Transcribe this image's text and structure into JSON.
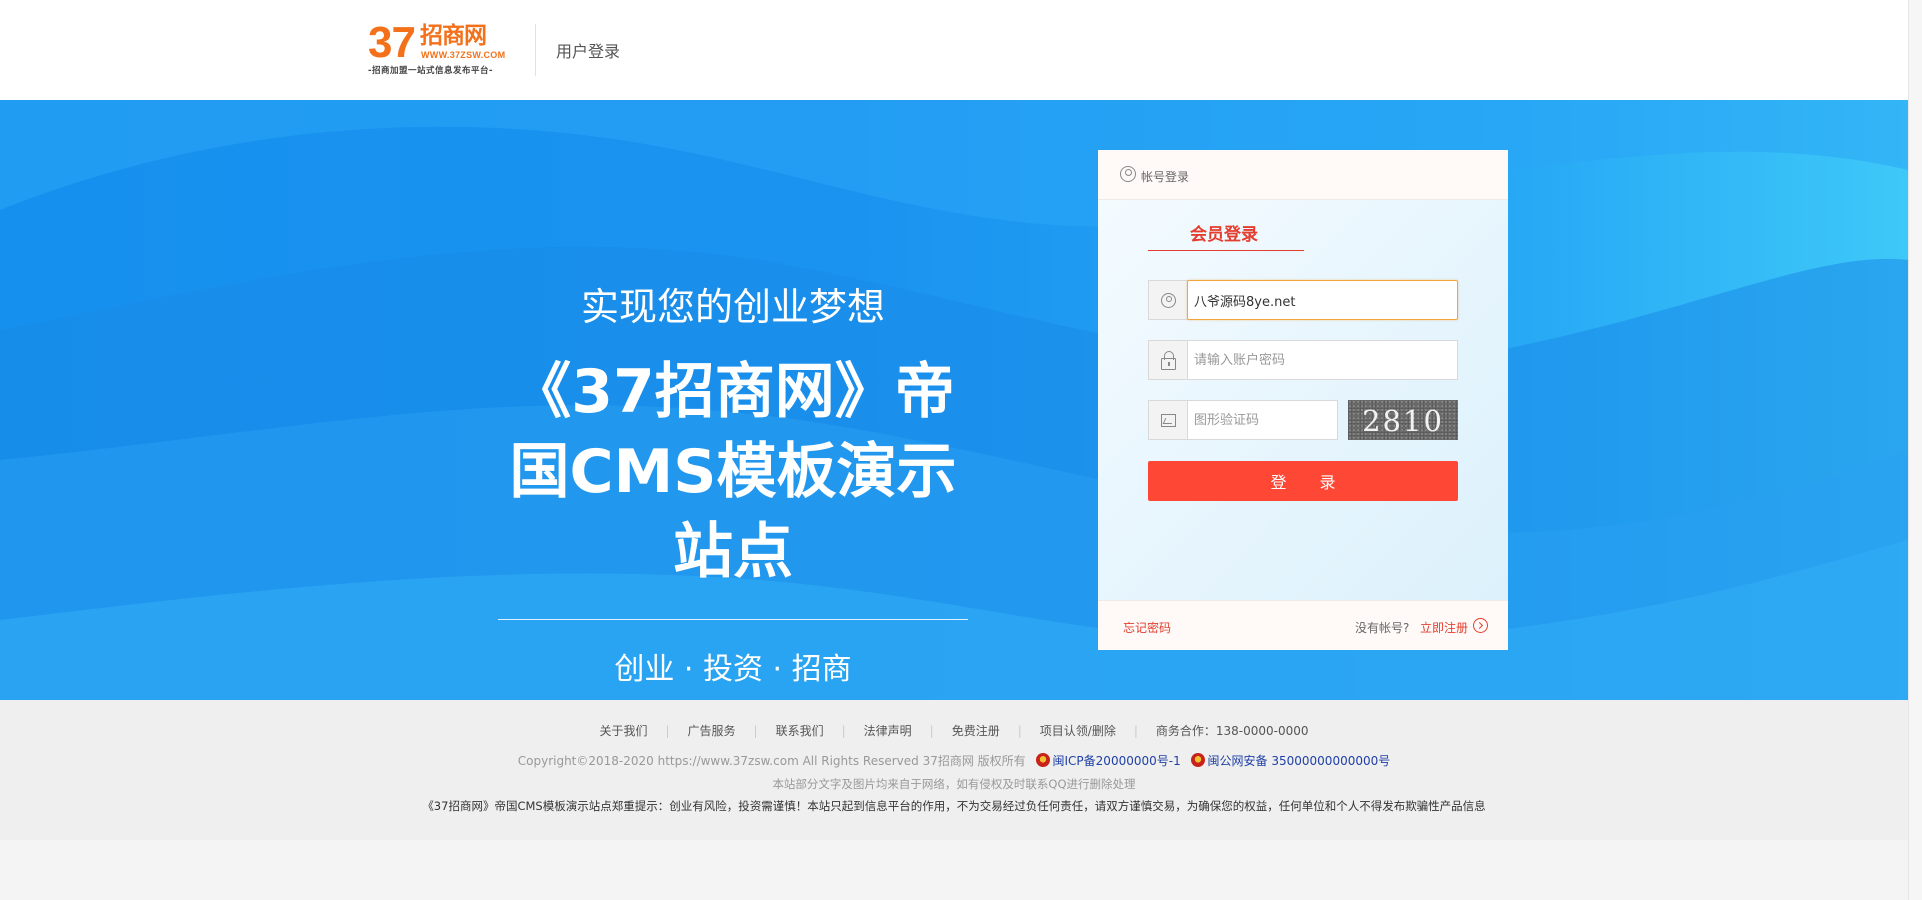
{
  "header": {
    "logo": {
      "number": "37",
      "name": "招商网",
      "url": "WWW.37ZSW.COM",
      "slogan": "-招商加盟一站式信息发布平台-"
    },
    "title": "用户登录"
  },
  "banner": {
    "slogan_top": "实现您的创业梦想",
    "headline": "《37招商网》帝国CMS模板演示站点",
    "slogan_bottom": "创业 · 投资 · 招商"
  },
  "login": {
    "tab_label": "帐号登录",
    "member_title": "会员登录",
    "username_value": "八爷源码8ye.net",
    "password_placeholder": "请输入账户密码",
    "captcha_placeholder": "图形验证码",
    "captcha_code": "2810",
    "submit_label": "登 录",
    "forgot_label": "忘记密码",
    "no_account_label": "没有帐号?",
    "register_label": "立即注册"
  },
  "footer": {
    "links": [
      "关于我们",
      "广告服务",
      "联系我们",
      "法律声明",
      "免费注册",
      "项目认领/删除",
      "商务合作：138-0000-0000"
    ],
    "copyright": "Copyright©2018-2020 https://www.37zsw.com All Rights Reserved  37招商网 版权所有",
    "icp": "闽ICP备20000000号-1",
    "police": "闽公网安备 35000000000000号",
    "disclaimer": "本站部分文字及图片均来自于网络，如有侵权及时联系QQ进行删除处理",
    "notice": "《37招商网》帝国CMS模板演示站点郑重提示：创业有风险，投资需谨慎！本站只起到信息平台的作用，不为交易经过负任何责任，请双方谨慎交易，为确保您的权益，任何单位和个人不得发布欺骗性产品信息"
  },
  "colors": {
    "brand_orange": "#f3711a",
    "accent_red": "#ff4736",
    "banner_blue": "#1a93f0"
  }
}
